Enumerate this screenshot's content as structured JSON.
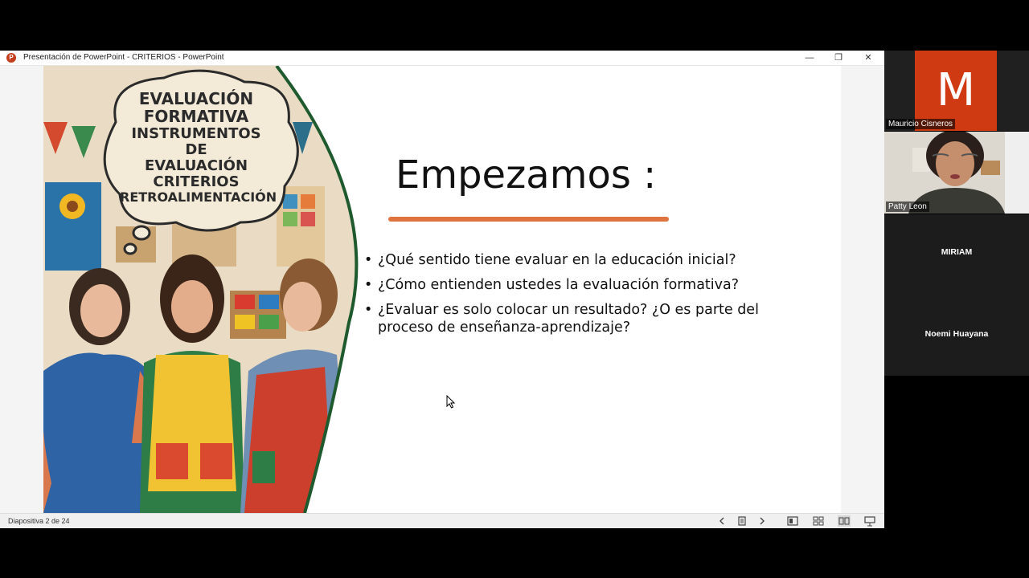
{
  "window": {
    "title": "Presentación de PowerPoint  -  CRITERIOS - PowerPoint",
    "app_icon": "powerpoint-icon",
    "app_icon_letter": "P",
    "minimize": "—",
    "restore": "❐",
    "close": "✕"
  },
  "slide": {
    "bubble_lines": [
      "EVALUACIÓN",
      "FORMATIVA",
      "INSTRUMENTOS DE",
      "EVALUACIÓN",
      "CRITERIOS",
      "RETROALIMENTACIÓN"
    ],
    "title": "Empezamos :",
    "bullets": [
      "¿Qué sentido tiene evaluar en la educación inicial?",
      "¿Cómo entienden ustedes la evaluación formativa?",
      "¿Evaluar es solo colocar un resultado?  ¿O es parte del proceso de enseñanza-aprendizaje?"
    ],
    "bullet_char": "•",
    "accent_color": "#e0743f"
  },
  "status": {
    "slide_counter": "Diapositiva 2 de 24"
  },
  "participants": {
    "presenter": {
      "initial": "M",
      "name": "Mauricio Cisneros",
      "color": "#cf3a12"
    },
    "camera": {
      "name": "Patty Leon"
    },
    "others": [
      "MIRIAM",
      "Noemi Huayana"
    ]
  }
}
